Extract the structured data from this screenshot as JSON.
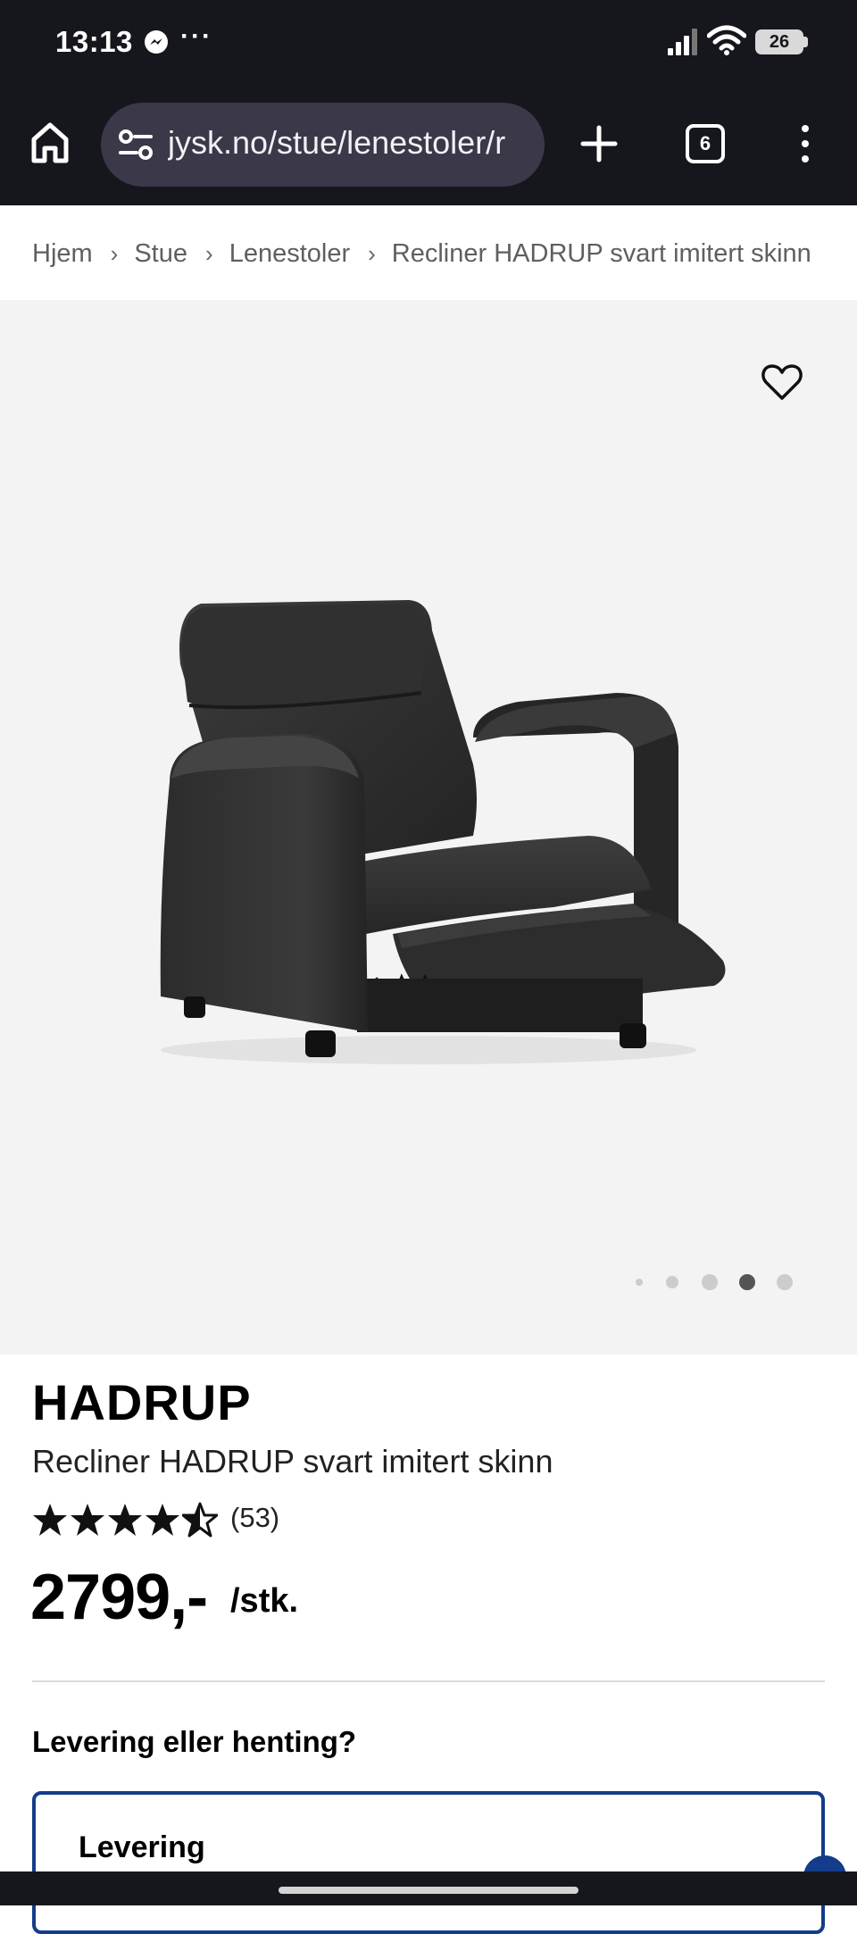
{
  "status_bar": {
    "time": "13:13",
    "more": "···",
    "battery": "26",
    "icons": [
      "messenger-icon",
      "signal-icon",
      "wifi-icon",
      "battery-icon"
    ]
  },
  "browser": {
    "url": "jysk.no/stue/lenestoler/r",
    "tab_count": "6",
    "icons": [
      "home-icon",
      "site-settings-icon",
      "new-tab-icon",
      "tab-switcher-icon",
      "more-menu-icon"
    ]
  },
  "breadcrumb": {
    "items": [
      "Hjem",
      "Stue",
      "Lenestoler",
      "Recliner HADRUP svart imitert skinn"
    ],
    "separator": "›"
  },
  "gallery": {
    "image_count": 5,
    "active_index": 3,
    "image_alt": "Recliner HADRUP svart imitert skinn",
    "colors": {
      "background": "#f3f3f3",
      "dot": "#cccccc",
      "dot_active": "#555555"
    }
  },
  "product": {
    "brand": "HADRUP",
    "name": "Recliner HADRUP svart imitert skinn",
    "rating": 4.5,
    "rating_max": 5,
    "review_count": "(53)",
    "price": "2799,-",
    "unit": "/stk."
  },
  "delivery": {
    "question": "Levering eller henting?",
    "option_label": "Levering",
    "accent": "#143c8a"
  }
}
